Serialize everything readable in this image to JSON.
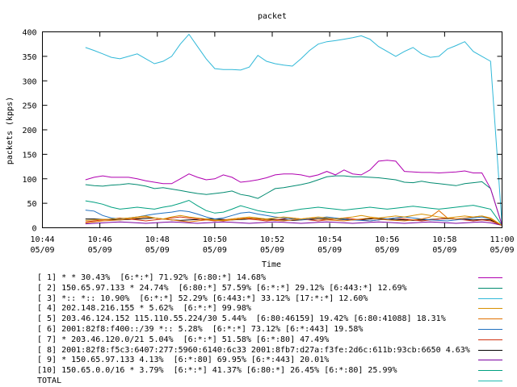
{
  "chart_data": {
    "type": "line",
    "title": "packet",
    "xlabel": "Time",
    "ylabel": "packets (kpps)",
    "ylim": [
      0,
      400
    ],
    "yticks": [
      0,
      50,
      100,
      150,
      200,
      250,
      300,
      350,
      400
    ],
    "xlim_minutes": [
      0,
      16
    ],
    "xticks": [
      {
        "minute": 0,
        "time": "10:44",
        "date": "05/09"
      },
      {
        "minute": 2,
        "time": "10:46",
        "date": "05/09"
      },
      {
        "minute": 4,
        "time": "10:48",
        "date": "05/09"
      },
      {
        "minute": 6,
        "time": "10:50",
        "date": "05/09"
      },
      {
        "minute": 8,
        "time": "10:52",
        "date": "05/09"
      },
      {
        "minute": 10,
        "time": "10:54",
        "date": "05/09"
      },
      {
        "minute": 12,
        "time": "10:56",
        "date": "05/09"
      },
      {
        "minute": 14,
        "time": "10:58",
        "date": "05/09"
      },
      {
        "minute": 16,
        "time": "11:00",
        "date": "05/09"
      }
    ],
    "grid": false,
    "legend_position": "bottom",
    "x_minutes": [
      1.5,
      1.8,
      2.1,
      2.4,
      2.7,
      3.0,
      3.3,
      3.6,
      3.9,
      4.2,
      4.5,
      4.8,
      5.1,
      5.4,
      5.7,
      6.0,
      6.3,
      6.6,
      6.9,
      7.2,
      7.5,
      7.8,
      8.1,
      8.4,
      8.7,
      9.0,
      9.3,
      9.6,
      9.9,
      10.2,
      10.5,
      10.8,
      11.1,
      11.4,
      11.7,
      12.0,
      12.3,
      12.6,
      12.9,
      13.2,
      13.5,
      13.8,
      14.1,
      14.4,
      14.7,
      15.0,
      15.3,
      15.6,
      16.0
    ],
    "series": [
      {
        "name": "[ 1] * * 30.43%  [6:*:*] 71.92% [6:80:*] 14.68%",
        "color": "#b000b0",
        "values": [
          98,
          103,
          106,
          103,
          103,
          103,
          100,
          96,
          93,
          90,
          90,
          100,
          110,
          103,
          98,
          100,
          108,
          103,
          93,
          95,
          98,
          102,
          108,
          110,
          110,
          108,
          104,
          108,
          115,
          108,
          118,
          110,
          108,
          118,
          136,
          138,
          136,
          115,
          114,
          113,
          113,
          112,
          113,
          114,
          116,
          112,
          112,
          80,
          5
        ]
      },
      {
        "name": "[ 2] 150.65.97.133 * 24.74%  [6:80:*] 57.59% [6:*:*] 29.12% [6:443:*] 12.69%",
        "color": "#008a70",
        "values": [
          88,
          86,
          85,
          87,
          88,
          90,
          88,
          85,
          80,
          82,
          79,
          76,
          73,
          70,
          68,
          70,
          72,
          75,
          68,
          65,
          60,
          70,
          80,
          82,
          85,
          88,
          92,
          98,
          104,
          106,
          106,
          104,
          104,
          103,
          102,
          100,
          98,
          93,
          92,
          95,
          92,
          90,
          88,
          86,
          90,
          92,
          94,
          80,
          5
        ]
      },
      {
        "name": "[ 3] *:: *:: 10.90%  [6:*:*] 52.29% [6:443:*] 33.12% [17:*:*] 12.60%",
        "color": "#30b8d8",
        "values": [
          368,
          362,
          355,
          348,
          345,
          350,
          355,
          345,
          335,
          340,
          350,
          375,
          395,
          370,
          345,
          325,
          323,
          323,
          322,
          328,
          352,
          340,
          335,
          332,
          330,
          345,
          362,
          375,
          380,
          382,
          385,
          388,
          392,
          385,
          370,
          360,
          350,
          360,
          368,
          355,
          348,
          350,
          365,
          372,
          380,
          360,
          350,
          340,
          5
        ]
      },
      {
        "name": "[ 4] 202.148.216.155 * 5.62%  [6:*:*] 99.98%",
        "color": "#d89000",
        "values": [
          15,
          16,
          17,
          18,
          19,
          20,
          22,
          24,
          20,
          18,
          22,
          25,
          22,
          20,
          18,
          16,
          15,
          18,
          20,
          22,
          20,
          18,
          20,
          22,
          20,
          18,
          20,
          22,
          20,
          18,
          20,
          22,
          25,
          22,
          20,
          22,
          24,
          22,
          25,
          28,
          25,
          22,
          20,
          22,
          24,
          22,
          24,
          20,
          5
        ]
      },
      {
        "name": "[ 5] 203.46.124.152 115.110.55.224/30 5.44%  [6:80:46159] 19.42% [6:80:41088] 18.31%",
        "color": "#e07000",
        "values": [
          10,
          12,
          14,
          15,
          16,
          18,
          20,
          22,
          20,
          18,
          16,
          14,
          12,
          14,
          16,
          15,
          14,
          16,
          18,
          20,
          18,
          16,
          15,
          14,
          16,
          18,
          20,
          18,
          16,
          15,
          14,
          16,
          18,
          20,
          18,
          16,
          15,
          14,
          16,
          18,
          22,
          35,
          20,
          18,
          20,
          22,
          24,
          18,
          5
        ]
      },
      {
        "name": "[ 6] 2001:82f8:f400::/39 *:: 5.28%  [6:*:*] 73.12% [6:*:443] 19.58%",
        "color": "#2070c0",
        "values": [
          36,
          34,
          25,
          20,
          18,
          20,
          22,
          25,
          28,
          30,
          32,
          35,
          33,
          28,
          22,
          18,
          20,
          25,
          30,
          32,
          28,
          25,
          22,
          20,
          18,
          16,
          18,
          20,
          22,
          20,
          18,
          16,
          15,
          14,
          16,
          18,
          20,
          22,
          20,
          18,
          16,
          15,
          14,
          16,
          18,
          20,
          22,
          18,
          5
        ]
      },
      {
        "name": "[ 7] * 203.46.120.0/21 5.04%  [6:*:*] 51.58% [6:*:80] 47.49%",
        "color": "#d03010",
        "values": [
          12,
          14,
          16,
          18,
          20,
          18,
          16,
          14,
          16,
          18,
          20,
          22,
          20,
          18,
          16,
          14,
          16,
          18,
          20,
          18,
          16,
          14,
          16,
          18,
          20,
          18,
          16,
          14,
          16,
          18,
          20,
          18,
          16,
          14,
          16,
          18,
          20,
          18,
          16,
          14,
          16,
          18,
          20,
          18,
          16,
          14,
          16,
          14,
          5
        ]
      },
      {
        "name": "[ 8] 2001:82f8:f5c3:6407:277:5960:6140:6c33 2001:8fb7:d27a:f3fe:2d6c:611b:93cb:6650 4.63%",
        "color": "#000000",
        "values": [
          18,
          18,
          17,
          17,
          16,
          17,
          18,
          19,
          20,
          18,
          16,
          15,
          16,
          17,
          18,
          18,
          17,
          16,
          17,
          18,
          19,
          18,
          17,
          16,
          15,
          16,
          17,
          18,
          19,
          18,
          17,
          16,
          17,
          18,
          19,
          18,
          17,
          16,
          15,
          16,
          17,
          18,
          19,
          18,
          17,
          16,
          17,
          16,
          5
        ]
      },
      {
        "name": "[ 9] * 150.65.97.133 4.13%  [6:*:80] 69.95% [6:*:443] 20.01%",
        "color": "#7a00a0",
        "values": [
          8,
          9,
          10,
          11,
          12,
          11,
          10,
          9,
          10,
          11,
          12,
          11,
          10,
          9,
          10,
          11,
          12,
          11,
          10,
          9,
          10,
          11,
          12,
          11,
          10,
          9,
          10,
          11,
          12,
          11,
          10,
          9,
          10,
          11,
          12,
          11,
          10,
          9,
          10,
          11,
          12,
          11,
          10,
          9,
          10,
          11,
          12,
          10,
          5
        ]
      },
      {
        "name": "[10] 150.65.0.0/16 * 3.79%  [6:*:*] 41.37% [6:80:*] 26.45% [6:*:80] 25.99%",
        "color": "#00a080",
        "values": [
          55,
          52,
          48,
          42,
          38,
          40,
          42,
          40,
          38,
          42,
          45,
          50,
          56,
          45,
          35,
          30,
          32,
          38,
          45,
          40,
          35,
          32,
          30,
          32,
          35,
          38,
          40,
          42,
          40,
          38,
          36,
          38,
          40,
          42,
          40,
          38,
          40,
          42,
          44,
          42,
          40,
          38,
          40,
          42,
          44,
          46,
          42,
          38,
          5
        ]
      },
      {
        "name": "TOTAL",
        "color": "#20b8b0",
        "values": null
      }
    ]
  }
}
